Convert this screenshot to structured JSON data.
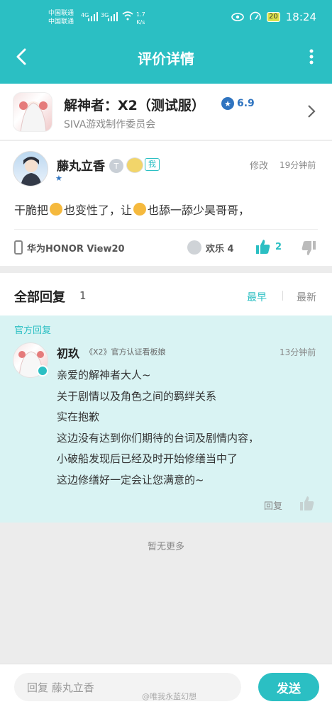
{
  "status_bar": {
    "carrier_1": "中国联通",
    "carrier_2": "中国联通",
    "sig_1": "4G",
    "sig_2": "3G",
    "net_speed": "1.7",
    "net_unit": "K/s",
    "battery": "20",
    "time": "18:24"
  },
  "nav": {
    "title": "评价详情"
  },
  "game": {
    "title": "解神者：X2（测试服）",
    "rating": "6.9",
    "developer": "SIVA游戏制作委员会"
  },
  "review": {
    "username": "藤丸立香",
    "level_badge": "T",
    "me_tag": "我",
    "edit_label": "修改",
    "time_ago": "19分钟前",
    "text_part1": "干脆把",
    "text_part2": "也变性了，让",
    "text_part3": "也舔一舔少昊哥哥，",
    "device": "华为HONOR View20",
    "fun_label": "欢乐 4",
    "like_count": "2"
  },
  "replies": {
    "title": "全部回复",
    "count": "1",
    "sort_early": "最早",
    "sort_new": "最新",
    "official_tag": "官方回复",
    "items": [
      {
        "name": "初玖",
        "role": "《X2》官方认证看板娘",
        "time_ago": "13分钟前",
        "lines": [
          "亲爱的解神者大人~",
          "关于剧情以及角色之间的羁绊关系",
          "实在抱歉",
          "这边没有达到你们期待的台词及剧情内容，",
          "小破船发现后已经及时开始修缮当中了",
          "这边修缮好一定会让您满意的~"
        ],
        "reply_label": "回复"
      }
    ],
    "no_more": "暂无更多"
  },
  "bottom": {
    "input_placeholder": "回复 藤丸立香",
    "send_label": "发送"
  },
  "watermark": "@唯我永蓝幻想",
  "colors": {
    "accent": "#2bbfc3",
    "official_bg": "#d9f3f3",
    "star": "#2f74c0"
  },
  "icons": [
    "back-arrow-icon",
    "more-vertical-icon",
    "star-icon",
    "chevron-right-icon",
    "phone-icon",
    "smile-icon",
    "thumbs-up-icon",
    "thumbs-down-icon",
    "verified-icon"
  ]
}
